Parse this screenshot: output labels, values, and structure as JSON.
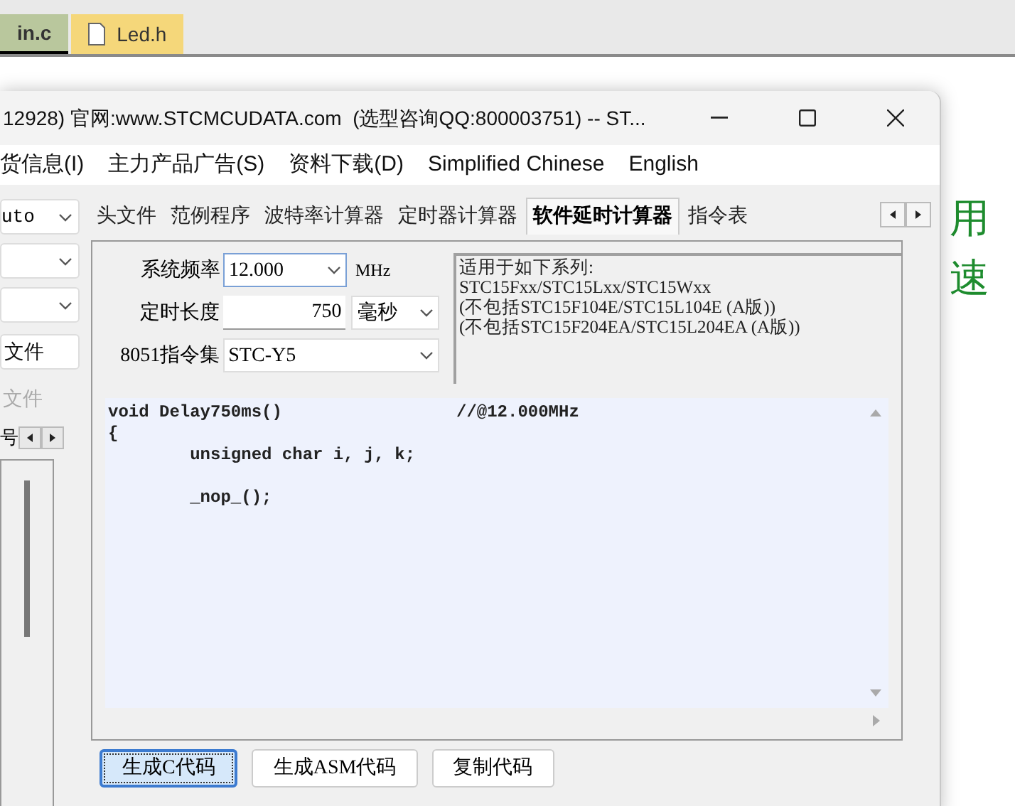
{
  "editor_tabs": [
    {
      "label": "in.c",
      "selected": true
    },
    {
      "label": "Led.h",
      "selected": false
    }
  ],
  "background_text": {
    "right_lines": [
      "用",
      "速"
    ]
  },
  "window": {
    "title": "12928) 官网:www.STCMCUDATA.com  (选型咨询QQ:800003751) -- ST..."
  },
  "menu": [
    "货信息(I)",
    "主力产品广告(S)",
    "资料下载(D)",
    "Simplified Chinese",
    "English"
  ],
  "left_panel": {
    "mode_select": "uto",
    "buttons": [
      {
        "label": "文件",
        "disabled": false
      },
      {
        "label": "文件",
        "disabled": true
      }
    ],
    "pager_label": "号"
  },
  "tabs": [
    {
      "label": "头文件",
      "selected": false
    },
    {
      "label": "范例程序",
      "selected": false
    },
    {
      "label": "波特率计算器",
      "selected": false
    },
    {
      "label": "定时器计算器",
      "selected": false
    },
    {
      "label": "软件延时计算器",
      "selected": true
    },
    {
      "label": "指令表",
      "selected": false
    }
  ],
  "delay_form": {
    "frequency": {
      "label": "系统频率",
      "value": "12.000",
      "unit": "MHz"
    },
    "length": {
      "label": "定时长度",
      "value": "750",
      "unit": "毫秒"
    },
    "instruction_set": {
      "label": "8051指令集",
      "value": "STC-Y5"
    }
  },
  "info_lines": [
    "适用于如下系列:",
    "STC15Fxx/STC15Lxx/STC15Wxx",
    "(不包括STC15F104E/STC15L104E (A版))",
    "(不包括STC15F204EA/STC15L204EA (A版))"
  ],
  "code": [
    {
      "kind": "line",
      "text": "void Delay750ms()",
      "comment": "//@12.000MHz"
    },
    {
      "kind": "line",
      "text": "{"
    },
    {
      "kind": "line",
      "text": "        unsigned char i, j, k;"
    },
    {
      "kind": "blank"
    },
    {
      "kind": "line",
      "text": "        _nop_();"
    }
  ],
  "buttons": [
    {
      "label": "生成C代码",
      "focused": true
    },
    {
      "label": "生成ASM代码",
      "focused": false
    },
    {
      "label": "复制代码",
      "focused": false
    }
  ]
}
